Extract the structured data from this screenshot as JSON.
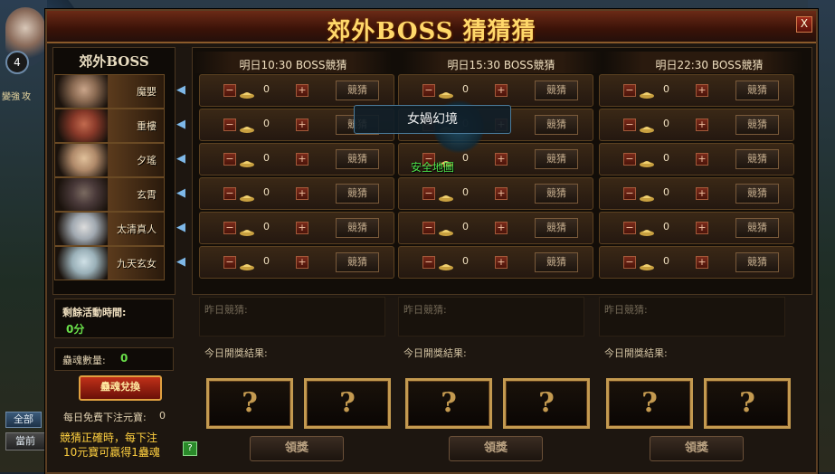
{
  "hud": {
    "level": "4",
    "side_labels": [
      "變強",
      "攻"
    ],
    "tabs": [
      "全部",
      "當前"
    ]
  },
  "window": {
    "title": "郊外BOSS 猜猜猜",
    "close_label": "X"
  },
  "boss_panel": {
    "title": "郊外BOSS",
    "bosses": [
      {
        "name": "魔嬰",
        "color": "#8a6a52"
      },
      {
        "name": "重樓",
        "color": "#8a3a2a"
      },
      {
        "name": "夕瑤",
        "color": "#b08a6a"
      },
      {
        "name": "玄霄",
        "color": "#4a3a3a"
      },
      {
        "name": "太清真人",
        "color": "#a0a8b0"
      },
      {
        "name": "九天玄女",
        "color": "#9ab0b8"
      }
    ]
  },
  "columns": [
    {
      "header": "明日10:30 BOSS競猜"
    },
    {
      "header": "明日15:30 BOSS競猜"
    },
    {
      "header": "明日22:30 BOSS競猜"
    }
  ],
  "bet": {
    "minus": "−",
    "plus": "+",
    "value": "0",
    "button": "競猜"
  },
  "tooltip": {
    "title": "女媧幻境",
    "safe_zone": "安全地圖"
  },
  "info": {
    "remaining_label": "剩餘活動時間:",
    "remaining_value": "0分",
    "soul_label": "蠱魂數量:",
    "soul_value": "0",
    "exchange_button": "蠱魂兌換",
    "free_label": "每日免費下注元寶:",
    "free_value": "0",
    "tip_line1": "競猜正確時，每下注",
    "tip_line2": "10元寶可贏得1蠱魂",
    "help": "?"
  },
  "results": {
    "yesterday_label": "昨日競猜:",
    "today_label": "今日開獎結果:",
    "mystery": "?",
    "claim_button": "領獎"
  }
}
